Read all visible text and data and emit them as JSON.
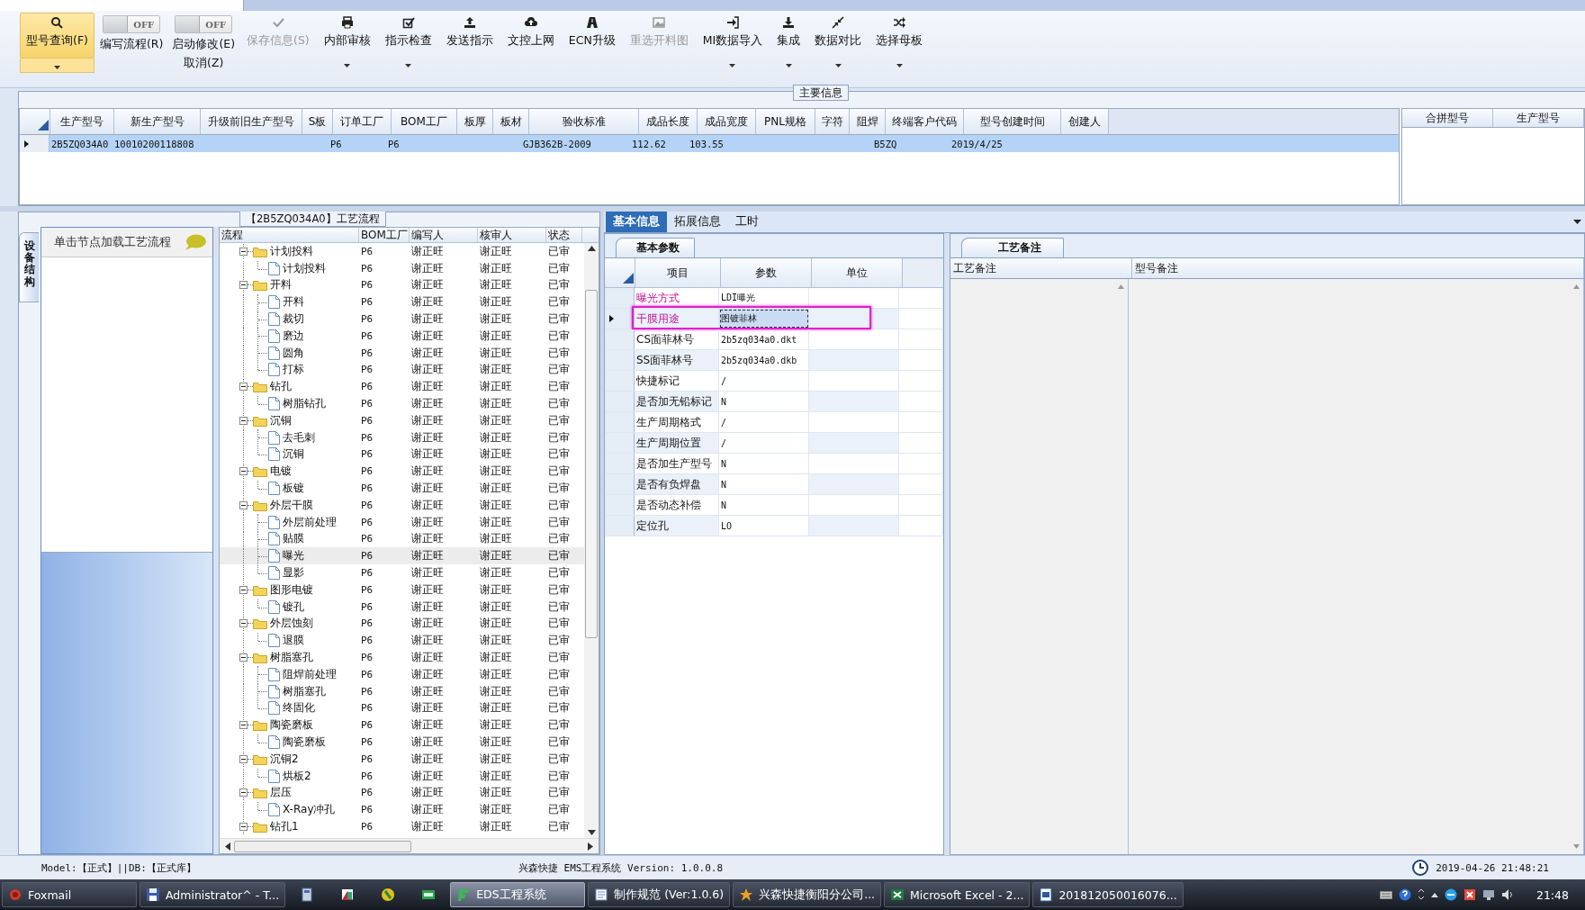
{
  "toolbar": [
    {
      "kind": "button",
      "label": "型号查询(F)",
      "selected": true,
      "disabled": false,
      "dropdown": true
    },
    {
      "kind": "toggle",
      "label": "编写流程(R)",
      "toggle": "OFF",
      "on": false
    },
    {
      "kind": "toggle",
      "label": "启动修改(E)",
      "sublabel": "取消(Z)",
      "toggle": "OFF",
      "on": false
    },
    {
      "kind": "button",
      "label": "保存信息(S)",
      "selected": false,
      "disabled": true,
      "dropdown": false
    },
    {
      "kind": "button",
      "label": "内部审核",
      "selected": false,
      "disabled": false,
      "dropdown": true
    },
    {
      "kind": "button",
      "label": "指示检查",
      "selected": false,
      "disabled": false,
      "dropdown": true
    },
    {
      "kind": "button",
      "label": "发送指示",
      "selected": false,
      "disabled": false,
      "dropdown": false
    },
    {
      "kind": "button",
      "label": "文控上网",
      "selected": false,
      "disabled": false,
      "dropdown": false
    },
    {
      "kind": "button",
      "label": "ECN升级",
      "selected": false,
      "disabled": false,
      "dropdown": false
    },
    {
      "kind": "button",
      "label": "重选开料图",
      "selected": false,
      "disabled": true,
      "dropdown": false
    },
    {
      "kind": "button",
      "label": "MI数据导入",
      "selected": false,
      "disabled": false,
      "dropdown": true
    },
    {
      "kind": "button",
      "label": "集成",
      "selected": false,
      "disabled": false,
      "dropdown": true
    },
    {
      "kind": "button",
      "label": "数据对比",
      "selected": false,
      "disabled": false,
      "dropdown": true
    },
    {
      "kind": "button",
      "label": "选择母板",
      "selected": false,
      "disabled": false,
      "dropdown": true
    }
  ],
  "main_info": {
    "title": "主要信息",
    "columns": [
      "生产型号",
      "新生产型号",
      "升级前旧生产型号",
      "S板",
      "订单工厂",
      "BOM工厂",
      "板厚",
      "板材",
      "验收标准",
      "成品长度",
      "成品宽度",
      "PNL规格",
      "字符",
      "阻焊",
      "终端客户代码",
      "型号创建时间",
      "创建人"
    ],
    "rows": [
      {
        "selected": true,
        "cells": [
          "2B5ZQ034A0",
          "10010200118808",
          null,
          null,
          "P6",
          "P6",
          null,
          null,
          "GJB362B-2009",
          "112.62",
          "103.55",
          null,
          null,
          null,
          "B5ZQ",
          "2019/4/25",
          null
        ]
      }
    ],
    "side_columns": [
      "合拼型号",
      "生产型号"
    ]
  },
  "process": {
    "title": "【2B5ZQ034A0】工艺流程",
    "side_tab": "设备结构",
    "hint": "单击节点加载工艺流程",
    "columns": [
      "流程",
      "BOM工厂",
      "编写人",
      "核审人",
      "状态"
    ],
    "tree": [
      {
        "name": "计划投料",
        "bom": "P6",
        "writer": "谢正旺",
        "reviewer": "谢正旺",
        "status": "已审",
        "expanded": true,
        "selected": false,
        "children": [
          {
            "name": "计划投料",
            "bom": "P6",
            "writer": "谢正旺",
            "reviewer": "谢正旺",
            "status": "已审",
            "selected": false
          }
        ]
      },
      {
        "name": "开料",
        "bom": "P6",
        "writer": "谢正旺",
        "reviewer": "谢正旺",
        "status": "已审",
        "expanded": true,
        "selected": false,
        "children": [
          {
            "name": "开料",
            "bom": "P6",
            "writer": "谢正旺",
            "reviewer": "谢正旺",
            "status": "已审",
            "selected": false
          },
          {
            "name": "裁切",
            "bom": "P6",
            "writer": "谢正旺",
            "reviewer": "谢正旺",
            "status": "已审",
            "selected": false
          },
          {
            "name": "磨边",
            "bom": "P6",
            "writer": "谢正旺",
            "reviewer": "谢正旺",
            "status": "已审",
            "selected": false
          },
          {
            "name": "圆角",
            "bom": "P6",
            "writer": "谢正旺",
            "reviewer": "谢正旺",
            "status": "已审",
            "selected": false
          },
          {
            "name": "打标",
            "bom": "P6",
            "writer": "谢正旺",
            "reviewer": "谢正旺",
            "status": "已审",
            "selected": false
          }
        ]
      },
      {
        "name": "钻孔",
        "bom": "P6",
        "writer": "谢正旺",
        "reviewer": "谢正旺",
        "status": "已审",
        "expanded": true,
        "selected": false,
        "children": [
          {
            "name": "树脂钻孔",
            "bom": "P6",
            "writer": "谢正旺",
            "reviewer": "谢正旺",
            "status": "已审",
            "selected": false
          }
        ]
      },
      {
        "name": "沉铜",
        "bom": "P6",
        "writer": "谢正旺",
        "reviewer": "谢正旺",
        "status": "已审",
        "expanded": true,
        "selected": false,
        "children": [
          {
            "name": "去毛刺",
            "bom": "P6",
            "writer": "谢正旺",
            "reviewer": "谢正旺",
            "status": "已审",
            "selected": false
          },
          {
            "name": "沉铜",
            "bom": "P6",
            "writer": "谢正旺",
            "reviewer": "谢正旺",
            "status": "已审",
            "selected": false
          }
        ]
      },
      {
        "name": "电镀",
        "bom": "P6",
        "writer": "谢正旺",
        "reviewer": "谢正旺",
        "status": "已审",
        "expanded": true,
        "selected": false,
        "children": [
          {
            "name": "板镀",
            "bom": "P6",
            "writer": "谢正旺",
            "reviewer": "谢正旺",
            "status": "已审",
            "selected": false
          }
        ]
      },
      {
        "name": "外层干膜",
        "bom": "P6",
        "writer": "谢正旺",
        "reviewer": "谢正旺",
        "status": "已审",
        "expanded": true,
        "selected": false,
        "children": [
          {
            "name": "外层前处理",
            "bom": "P6",
            "writer": "谢正旺",
            "reviewer": "谢正旺",
            "status": "已审",
            "selected": false
          },
          {
            "name": "贴膜",
            "bom": "P6",
            "writer": "谢正旺",
            "reviewer": "谢正旺",
            "status": "已审",
            "selected": false
          },
          {
            "name": "曝光",
            "bom": "P6",
            "writer": "谢正旺",
            "reviewer": "谢正旺",
            "status": "已审",
            "selected": true
          },
          {
            "name": "显影",
            "bom": "P6",
            "writer": "谢正旺",
            "reviewer": "谢正旺",
            "status": "已审",
            "selected": false
          }
        ]
      },
      {
        "name": "图形电镀",
        "bom": "P6",
        "writer": "谢正旺",
        "reviewer": "谢正旺",
        "status": "已审",
        "expanded": true,
        "selected": false,
        "children": [
          {
            "name": "镀孔",
            "bom": "P6",
            "writer": "谢正旺",
            "reviewer": "谢正旺",
            "status": "已审",
            "selected": false
          }
        ]
      },
      {
        "name": "外层蚀刻",
        "bom": "P6",
        "writer": "谢正旺",
        "reviewer": "谢正旺",
        "status": "已审",
        "expanded": true,
        "selected": false,
        "children": [
          {
            "name": "退膜",
            "bom": "P6",
            "writer": "谢正旺",
            "reviewer": "谢正旺",
            "status": "已审",
            "selected": false
          }
        ]
      },
      {
        "name": "树脂塞孔",
        "bom": "P6",
        "writer": "谢正旺",
        "reviewer": "谢正旺",
        "status": "已审",
        "expanded": true,
        "selected": false,
        "children": [
          {
            "name": "阻焊前处理",
            "bom": "P6",
            "writer": "谢正旺",
            "reviewer": "谢正旺",
            "status": "已审",
            "selected": false
          },
          {
            "name": "树脂塞孔",
            "bom": "P6",
            "writer": "谢正旺",
            "reviewer": "谢正旺",
            "status": "已审",
            "selected": false
          },
          {
            "name": "终固化",
            "bom": "P6",
            "writer": "谢正旺",
            "reviewer": "谢正旺",
            "status": "已审",
            "selected": false
          }
        ]
      },
      {
        "name": "陶瓷磨板",
        "bom": "P6",
        "writer": "谢正旺",
        "reviewer": "谢正旺",
        "status": "已审",
        "expanded": true,
        "selected": false,
        "children": [
          {
            "name": "陶瓷磨板",
            "bom": "P6",
            "writer": "谢正旺",
            "reviewer": "谢正旺",
            "status": "已审",
            "selected": false
          }
        ]
      },
      {
        "name": "沉铜2",
        "bom": "P6",
        "writer": "谢正旺",
        "reviewer": "谢正旺",
        "status": "已审",
        "expanded": true,
        "selected": false,
        "children": [
          {
            "name": "烘板2",
            "bom": "P6",
            "writer": "谢正旺",
            "reviewer": "谢正旺",
            "status": "已审",
            "selected": false
          }
        ]
      },
      {
        "name": "层压",
        "bom": "P6",
        "writer": "谢正旺",
        "reviewer": "谢正旺",
        "status": "已审",
        "expanded": true,
        "selected": false,
        "children": [
          {
            "name": "X-Ray冲孔",
            "bom": "P6",
            "writer": "谢正旺",
            "reviewer": "谢正旺",
            "status": "已审",
            "selected": false
          }
        ]
      },
      {
        "name": "钻孔1",
        "bom": "P6",
        "writer": "谢正旺",
        "reviewer": "谢正旺",
        "status": "已审",
        "expanded": true,
        "selected": false
      }
    ]
  },
  "details": {
    "tabs": [
      {
        "label": "基本信息",
        "selected": true
      },
      {
        "label": "拓展信息",
        "selected": false
      },
      {
        "label": "工时",
        "selected": false
      }
    ],
    "params_tab": "基本参数",
    "params_columns": [
      "项目",
      "参数",
      "单位"
    ],
    "params": [
      {
        "name": "曝光方式",
        "value": "LDI曝光",
        "flagged": true,
        "current": false
      },
      {
        "name": "干膜用途",
        "value": "图镀菲林",
        "flagged": true,
        "current": true
      },
      {
        "name": "CS面菲林号",
        "value": "2b5zq034a0.dkt",
        "flagged": false,
        "current": false
      },
      {
        "name": "SS面菲林号",
        "value": "2b5zq034a0.dkb",
        "flagged": false,
        "current": false
      },
      {
        "name": "快捷标记",
        "value": "/",
        "flagged": false,
        "current": false
      },
      {
        "name": "是否加无铅标记",
        "value": "N",
        "flagged": false,
        "current": false
      },
      {
        "name": "生产周期格式",
        "value": "/",
        "flagged": false,
        "current": false
      },
      {
        "name": "生产周期位置",
        "value": "/",
        "flagged": false,
        "current": false
      },
      {
        "name": "是否加生产型号",
        "value": "N",
        "flagged": false,
        "current": false
      },
      {
        "name": "是否有负焊盘",
        "value": "N",
        "flagged": false,
        "current": false
      },
      {
        "name": "是否动态补偿",
        "value": "N",
        "flagged": false,
        "current": false
      },
      {
        "name": "定位孔",
        "value": "LO",
        "flagged": false,
        "current": false
      }
    ],
    "notes_tab": "工艺备注",
    "notes_columns": [
      "工艺备注",
      "型号备注"
    ]
  },
  "status_bar": {
    "model": "Model:【正式】||DB:【正式库】",
    "app": "兴森快捷 EMS工程系统 Version: 1.0.0.8",
    "datetime": "2019-04-26 21:48:21"
  },
  "taskbar": {
    "items": [
      {
        "kind": "window",
        "label": "Foxmail",
        "selected": false
      },
      {
        "kind": "window",
        "label": "Administrator^ - T...",
        "selected": false
      },
      {
        "kind": "icon"
      },
      {
        "kind": "icon"
      },
      {
        "kind": "icon"
      },
      {
        "kind": "icon"
      },
      {
        "kind": "window",
        "label": "EDS工程系统",
        "selected": true
      },
      {
        "kind": "window",
        "label": "制作规范 (Ver:1.0.6)",
        "selected": false
      },
      {
        "kind": "window",
        "label": "兴森快捷衡阳分公司...",
        "selected": false
      },
      {
        "kind": "window",
        "label": "Microsoft Excel - 2...",
        "selected": false
      },
      {
        "kind": "window",
        "label": "201812050016076...",
        "selected": false
      }
    ],
    "clock": "21:48"
  }
}
